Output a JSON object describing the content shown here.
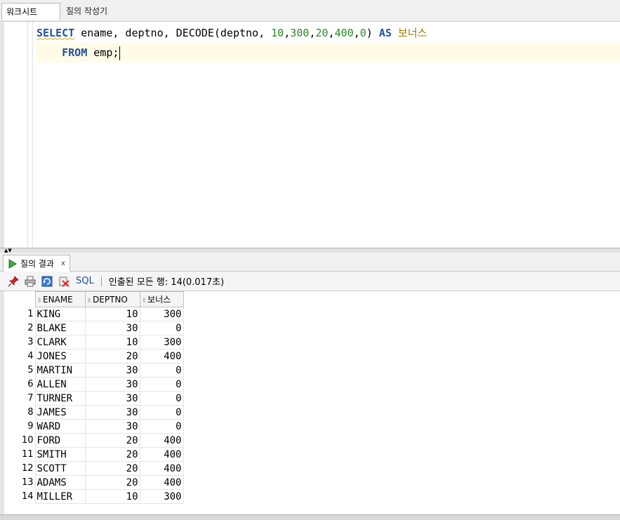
{
  "tabs": {
    "worksheet": "워크시트",
    "query_builder": "질의 작성기"
  },
  "editor": {
    "line1": {
      "select": "SELECT",
      "cols": " ename, deptno, DECODE(deptno, ",
      "n1": "10",
      "c1": ",",
      "n2": "300",
      "c2": ",",
      "n3": "20",
      "c3": ",",
      "n4": "400",
      "c4": ",",
      "n5": "0",
      "close": ") ",
      "as": "AS",
      "space": " ",
      "alias": "보너스"
    },
    "line2": {
      "indent": "    ",
      "from": "FROM",
      "rest": " emp;"
    }
  },
  "results": {
    "tab_label": "질의 결과",
    "close": "x",
    "sql_link": "SQL",
    "status": "인출된 모든 행: 14(0.017초)",
    "columns": [
      "ENAME",
      "DEPTNO",
      "보너스"
    ],
    "rows": [
      {
        "n": "1",
        "ename": "KING",
        "deptno": "10",
        "bonus": "300"
      },
      {
        "n": "2",
        "ename": "BLAKE",
        "deptno": "30",
        "bonus": "0"
      },
      {
        "n": "3",
        "ename": "CLARK",
        "deptno": "10",
        "bonus": "300"
      },
      {
        "n": "4",
        "ename": "JONES",
        "deptno": "20",
        "bonus": "400"
      },
      {
        "n": "5",
        "ename": "MARTIN",
        "deptno": "30",
        "bonus": "0"
      },
      {
        "n": "6",
        "ename": "ALLEN",
        "deptno": "30",
        "bonus": "0"
      },
      {
        "n": "7",
        "ename": "TURNER",
        "deptno": "30",
        "bonus": "0"
      },
      {
        "n": "8",
        "ename": "JAMES",
        "deptno": "30",
        "bonus": "0"
      },
      {
        "n": "9",
        "ename": "WARD",
        "deptno": "30",
        "bonus": "0"
      },
      {
        "n": "10",
        "ename": "FORD",
        "deptno": "20",
        "bonus": "400"
      },
      {
        "n": "11",
        "ename": "SMITH",
        "deptno": "20",
        "bonus": "400"
      },
      {
        "n": "12",
        "ename": "SCOTT",
        "deptno": "20",
        "bonus": "400"
      },
      {
        "n": "13",
        "ename": "ADAMS",
        "deptno": "20",
        "bonus": "400"
      },
      {
        "n": "14",
        "ename": "MILLER",
        "deptno": "10",
        "bonus": "300"
      }
    ]
  },
  "icons": {
    "pin": "pin-icon",
    "print": "print-icon",
    "refresh": "refresh-icon",
    "clear": "clear-icon",
    "run": "run-query-icon",
    "sort": "sort-icon"
  }
}
